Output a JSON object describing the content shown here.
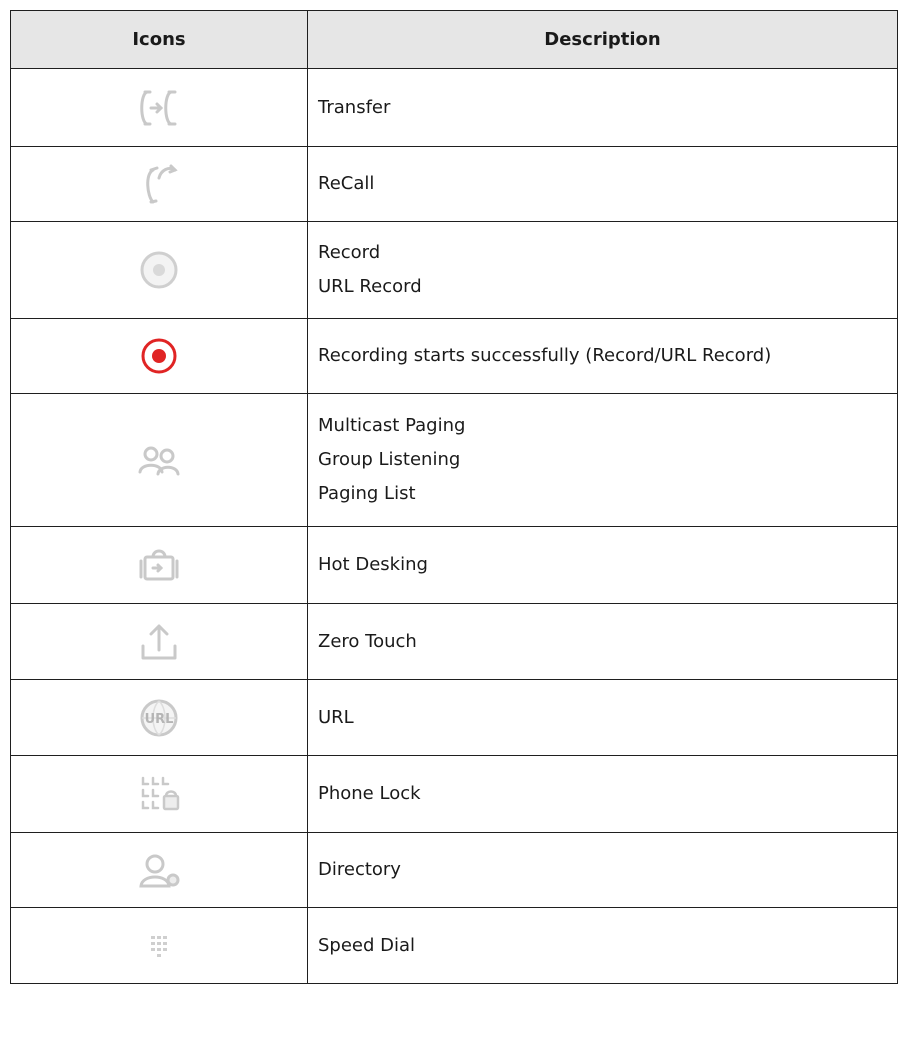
{
  "table": {
    "headers": {
      "icons": "Icons",
      "description": "Description"
    },
    "rows": [
      {
        "icon": "transfer-icon",
        "lines": [
          "Transfer"
        ]
      },
      {
        "icon": "recall-icon",
        "lines": [
          "ReCall"
        ]
      },
      {
        "icon": "record-icon",
        "lines": [
          "Record",
          "URL Record"
        ]
      },
      {
        "icon": "recording-active-icon",
        "lines": [
          "Recording starts successfully (Record/URL Record)"
        ]
      },
      {
        "icon": "paging-group-icon",
        "lines": [
          "Multicast Paging",
          "Group Listening",
          "Paging List"
        ]
      },
      {
        "icon": "hot-desking-icon",
        "lines": [
          "Hot Desking"
        ]
      },
      {
        "icon": "zero-touch-icon",
        "lines": [
          "Zero Touch"
        ]
      },
      {
        "icon": "url-icon",
        "lines": [
          "URL"
        ]
      },
      {
        "icon": "phone-lock-icon",
        "lines": [
          "Phone Lock"
        ]
      },
      {
        "icon": "directory-icon",
        "lines": [
          "Directory"
        ]
      },
      {
        "icon": "speed-dial-icon",
        "lines": [
          "Speed Dial"
        ]
      }
    ]
  },
  "colors": {
    "icon_gray": "#c9c9c9",
    "record_red": "#e02424",
    "header_bg": "#e6e6e6",
    "border": "#1f1f1f"
  }
}
